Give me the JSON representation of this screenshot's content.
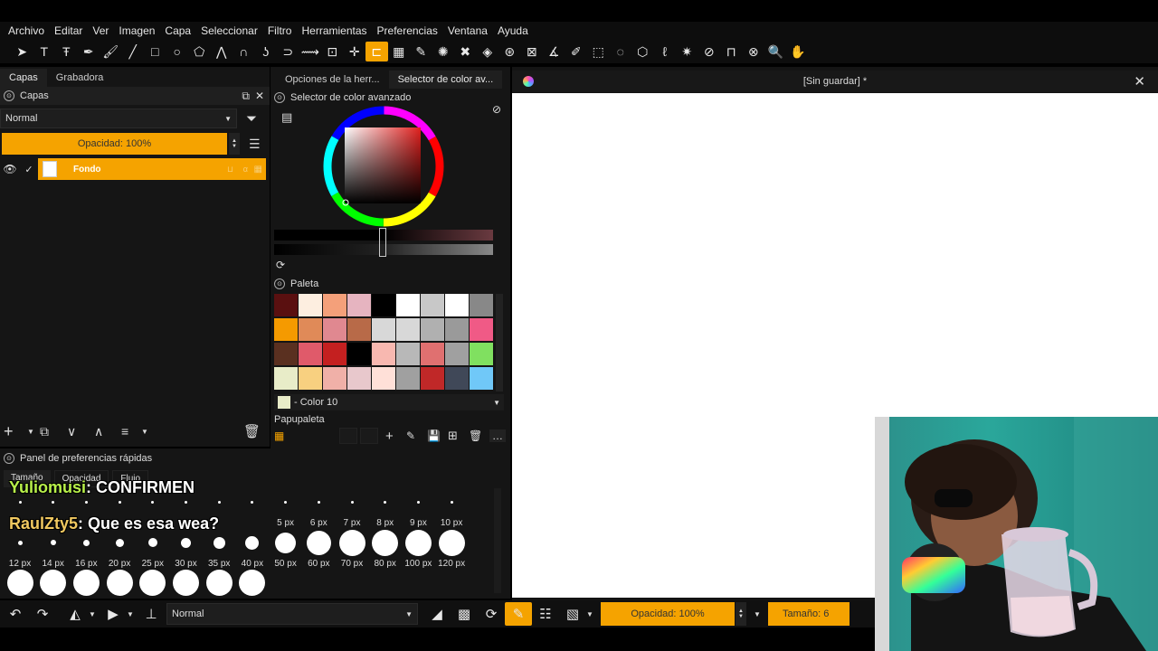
{
  "menu": [
    "Archivo",
    "Editar",
    "Ver",
    "Imagen",
    "Capa",
    "Seleccionar",
    "Filtro",
    "Herramientas",
    "Preferencias",
    "Ventana",
    "Ayuda"
  ],
  "left_tabs": [
    "Capas",
    "Grabadora"
  ],
  "layers": {
    "title": "Capas",
    "blend_mode": "Normal",
    "opacity": "Opacidad:  100%",
    "layer_name": "Fondo"
  },
  "mid_tabs": [
    "Opciones de la herr...",
    "Selector de color av..."
  ],
  "color_selector_title": "Selector de color avanzado",
  "palette": {
    "title": "Paleta",
    "current_color": "- Color 10",
    "papupaleta": "Papupaleta",
    "colors": [
      "#5a1010",
      "#fdeee0",
      "#f4a07a",
      "#e6b4c0",
      "#000000",
      "#ffffff",
      "#c8c8c8",
      "#ffffff",
      "#888888",
      "#f59a00",
      "#e08a58",
      "#e08890",
      "#b86a48",
      "#d8d8d8",
      "#d8d8d8",
      "#b0b0b0",
      "#9a9a9a",
      "#f05a86",
      "#5a3020",
      "#e05a6a",
      "#c42020",
      "#000000",
      "#f8b8b0",
      "#b8b8b8",
      "#e07070",
      "#a0a0a0",
      "#80e060",
      "#e8ecc8",
      "#f8d080",
      "#f0b0a8",
      "#e8c8cc",
      "#ffe0d8",
      "#a0a0a0",
      "#c02828",
      "#404858",
      "#70c8f8"
    ]
  },
  "quick_panel": {
    "title": "Panel de preferencias rápidas",
    "tabs": [
      "Tamaño",
      "Opacidad",
      "Flujo"
    ],
    "row1_labels": [
      "5 px",
      "6 px",
      "7 px",
      "8 px",
      "9 px",
      "10 px"
    ],
    "row2_labels": [
      "12 px",
      "14 px",
      "16 px",
      "20 px",
      "25 px",
      "30 px",
      "35 px",
      "40 px",
      "50 px",
      "60 px",
      "70 px",
      "80 px",
      "100 px",
      "120 px"
    ]
  },
  "document": {
    "title": "[Sin guardar] *"
  },
  "bottombar": {
    "blend_mode": "Normal",
    "opacity": "Opacidad:  100%",
    "size": "Tamaño: 6"
  },
  "chat": [
    {
      "user": "Yuliomusi",
      "message": ": CONFIRMEN",
      "color": "#b8f04a"
    },
    {
      "user": "RaulZty5",
      "message": ": Que es esa wea?",
      "color": "#f0c860"
    }
  ],
  "colors": {
    "accent": "#f5a300",
    "background": "#151515"
  }
}
